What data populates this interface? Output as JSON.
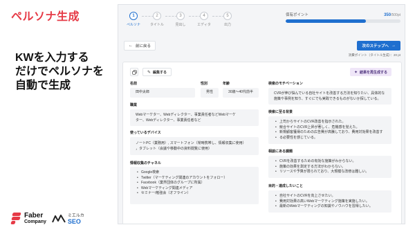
{
  "slide": {
    "heading": "ペルソナ生成",
    "subtitle_lines": [
      "KWを入力する",
      "だけでペルソナを",
      "自動で生成"
    ],
    "logos": {
      "faber_line1": "Faber",
      "faber_line2": "Company",
      "mieruca_line1": "ミエルカ",
      "mieruca_line2": "SEO"
    }
  },
  "stepper": {
    "steps": [
      {
        "num": "1",
        "label": "ペルソナ",
        "active": true
      },
      {
        "num": "2",
        "label": "タイトル",
        "active": false
      },
      {
        "num": "3",
        "label": "見出し",
        "active": false
      },
      {
        "num": "4",
        "label": "エディタ",
        "active": false
      },
      {
        "num": "5",
        "label": "出力",
        "active": false
      }
    ]
  },
  "points": {
    "label": "保有ポイント",
    "value": "350",
    "max": "/500pt",
    "fill_fraction": 0.7
  },
  "nav": {
    "back_label": "前に戻る",
    "next_label": "次のステップへ",
    "consume_text": "消費ポイント（タイトル生成）：20 pt"
  },
  "card": {
    "edit_label": "編集する",
    "regen_label": "結果を再生成する",
    "fields": {
      "name": {
        "label": "名前",
        "value": "田中太郎"
      },
      "gender": {
        "label": "性別",
        "value": "男性"
      },
      "age": {
        "label": "年齢",
        "value": "30歳〜40代前半"
      },
      "job": {
        "label": "職業",
        "lines": [
          "Webマーケター、Webディレクター、事業責任者などWebマーケ",
          "ター、Webディレクター、事業責任者など"
        ]
      },
      "devices": {
        "label": "使っているデバイス",
        "lines": [
          "ノートPC（業務用）, スマートフォン（常時携帯し、情報収集に使用）",
          "，タブレット（会議や移動中の資料閲覧に使用）"
        ]
      },
      "channels": {
        "label": "情報収集のチャネル",
        "items": [
          "Google検索",
          "Twitter（マーケティング関連のアカウントをフォロー）",
          "Facebook（業界団体のグループに所属）",
          "Webマーケティング関連メディア",
          "セミナー/勉強会（オフライン）"
        ]
      },
      "motivation": {
        "label": "検索のモチベーション",
        "lines": [
          "CVRが伸び悩んでいる自社サイトを改善する方法を知りたい、具体的な",
          "施策や事例を知り、すぐにでも実践できるものがないか探している。"
        ]
      },
      "background": {
        "label": "検索に至る背景",
        "items": [
          "上司からサイトのCVR改善を指示された。",
          "競合サイトのCVR上昇が著しく、危機感を覚えた。",
          "新規顧客獲得のための広告費が高騰しており、費用対効果を改善す",
          "る必要性を感じている。"
        ]
      },
      "issues": {
        "label": "相談にある課題",
        "items": [
          "CVRを改善するための有効な施策がわからない。",
          "施策の効果を測定する方法がわからない。",
          "リソースや予算が限られており、大規模な改修は難しい。"
        ]
      },
      "goals": {
        "label": "目的・達成したいこと",
        "items": [
          "自社サイトのCVRを向上させたい。",
          "費用対効果の高いWebマーケティング施策を実施したい。",
          "最新のWebマーケティングの知識やノウハウを習得したい。"
        ]
      }
    }
  }
}
